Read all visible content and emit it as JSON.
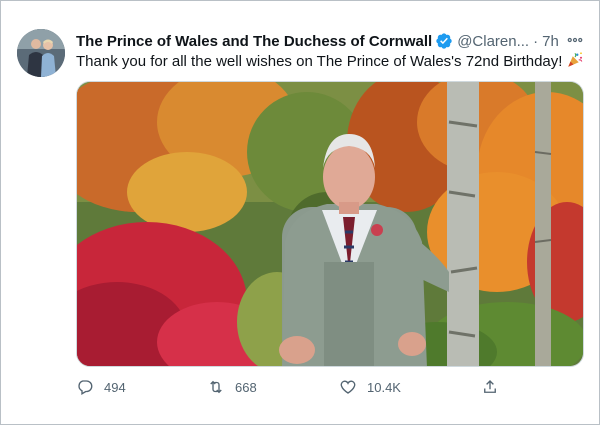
{
  "tweet": {
    "display_name": "The Prince of Wales and The Duchess of Cornwall",
    "handle": "@Claren...",
    "separator": "·",
    "time": "7h",
    "verified": true,
    "text": "Thank you for all the well wishes on The Prince of Wales's 72nd Birthday!",
    "emoji_icon": "party-popper-icon"
  },
  "actions": {
    "reply_count": "494",
    "retweet_count": "668",
    "like_count": "10.4K"
  },
  "colors": {
    "verified_blue": "#1d9bf0",
    "text_primary": "#0f1419",
    "text_secondary": "#536471"
  },
  "icons": {
    "verified": "verified-badge-icon",
    "more": "more-options-icon",
    "reply": "reply-icon",
    "retweet": "retweet-icon",
    "like": "heart-icon",
    "share": "share-icon"
  }
}
